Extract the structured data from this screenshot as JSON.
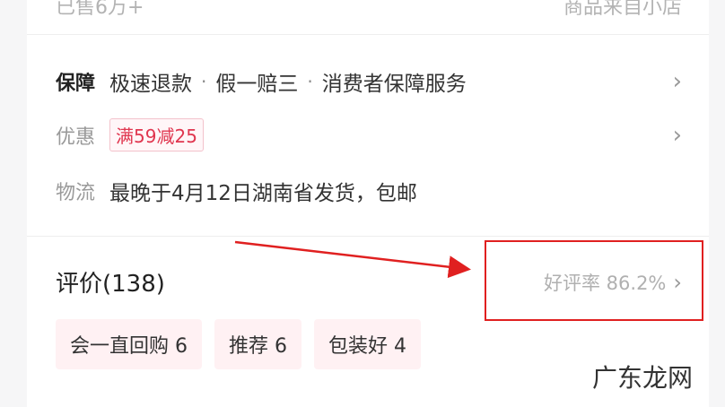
{
  "header": {
    "sold_text": "已售6万+",
    "store_text": "商品来自小店"
  },
  "guarantee": {
    "label": "保障",
    "items": [
      "极速退款",
      "假一赔三",
      "消费者保障服务"
    ],
    "separator": "·"
  },
  "discount": {
    "label": "优惠",
    "tag": "满59减25"
  },
  "logistics": {
    "label": "物流",
    "text": "最晚于4月12日湖南省发货，包邮"
  },
  "reviews": {
    "title": "评价(138)",
    "rating_text": "好评率 86.2%",
    "tags": [
      {
        "label": "会一直回购 6"
      },
      {
        "label": "推荐 6"
      },
      {
        "label": "包装好 4"
      }
    ]
  },
  "icons": {
    "chevron": "›"
  },
  "watermark": {
    "text": "广东龙网"
  },
  "colors": {
    "accent_red": "#e02020",
    "promo_red": "#e0364f",
    "tag_bg": "#fff1f3"
  }
}
